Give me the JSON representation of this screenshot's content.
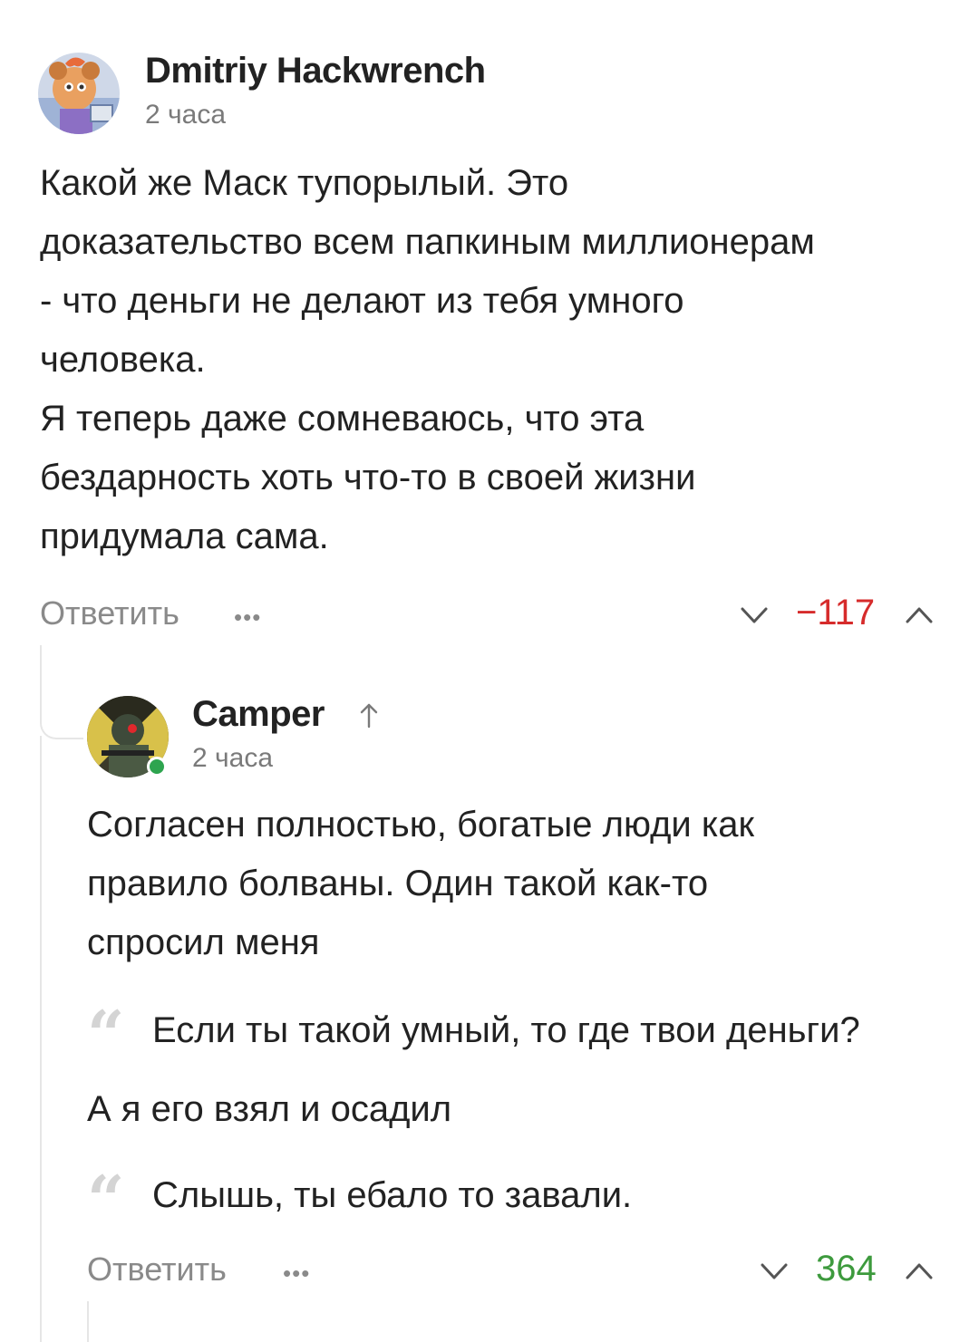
{
  "comments": [
    {
      "author": "Dmitriy Hackwrench",
      "time": "2 часа",
      "body": [
        "Какой же Маск тупорылый. Это",
        "доказательство всем папкиным миллионерам",
        "- что деньги не делают из тебя умного",
        "человека.",
        "Я теперь даже сомневаюсь, что эта",
        "бездарность хоть что-то в своей жизни",
        "придумала сама."
      ],
      "reply_label": "Ответить",
      "more_label": "•••",
      "rating": "−117",
      "rating_color": "#d62b2b"
    },
    {
      "author": "Camper",
      "time": "2 часа",
      "author_badge_icon": "up-arrow-icon",
      "online": true,
      "body": [
        "Согласен полностью, богатые люди как",
        "правило болваны. Один такой как-то",
        "спросил меня"
      ],
      "quote1": "Если ты такой умный, то где твои деньги?",
      "middle_line": "А я его взял и осадил",
      "quote2": "Слышь, ты ебало то завали.",
      "quote_mark": "“",
      "reply_label": "Ответить",
      "more_label": "•••",
      "rating": "364",
      "rating_color": "#3d9a3d"
    }
  ],
  "colors": {
    "muted": "#8a8a8a",
    "thread_line": "#e6e6e6",
    "online": "#2ea44f"
  }
}
